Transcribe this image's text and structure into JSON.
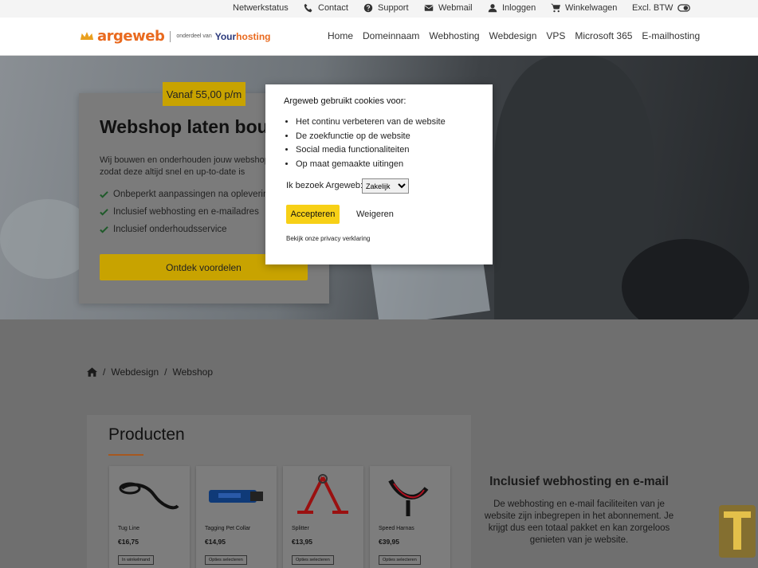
{
  "topbar": {
    "network_status": "Netwerkstatus",
    "contact": "Contact",
    "support": "Support",
    "webmail": "Webmail",
    "login": "Inloggen",
    "cart": "Winkelwagen",
    "vat": "Excl. BTW"
  },
  "logo": {
    "brand": "argeweb",
    "sub": "onderdeel van",
    "partner_a": "Your",
    "partner_b": "hosting"
  },
  "menu": [
    "Home",
    "Domeinnaam",
    "Webhosting",
    "Webdesign",
    "VPS",
    "Microsoft 365",
    "E-mailhosting"
  ],
  "hero": {
    "price_badge": "Vanaf 55,00 p/m",
    "title": "Webshop laten bouwen",
    "text": "Wij bouwen en onderhouden jouw webshop, zodat deze altijd snel en up-to-date is",
    "checks": [
      "Onbeperkt aanpassingen na oplevering",
      "Inclusief webhosting en e-mailadres",
      "Inclusief onderhoudsservice"
    ],
    "cta": "Ontdek voordelen"
  },
  "breadcrumb": {
    "home_icon": "home-icon",
    "items": [
      "Webdesign",
      "Webshop"
    ],
    "separator": "/"
  },
  "products": {
    "title": "Producten",
    "items": [
      {
        "name": "Tug Line",
        "price": "€16,75",
        "button": "In winkelmand",
        "icon": "leash"
      },
      {
        "name": "Tagging Pet Collar",
        "price": "€14,95",
        "button": "Opties selecteren",
        "icon": "collar"
      },
      {
        "name": "Splitter",
        "price": "€13,95",
        "button": "Opties selecteren",
        "icon": "splitter"
      },
      {
        "name": "Speed Harnas",
        "price": "€39,95",
        "button": "Opties selecteren",
        "icon": "harness"
      }
    ]
  },
  "side": {
    "title": "Inclusief webhosting en e-mail",
    "text": "De webhosting en e-mail faciliteiten van je website zijn inbegrepen in het abonnement. Je krijgt dus een totaal pakket en kan zorgeloos genieten van je website."
  },
  "cookie": {
    "heading": "Argeweb gebruikt cookies voor:",
    "items": [
      "Het continu verbeteren van de website",
      "De zoekfunctie op de website",
      "Social media functionaliteiten",
      "Op maat gemaakte uitingen"
    ],
    "visit_label": "Ik bezoek Argeweb:",
    "visit_value": "Zakelijk",
    "accept": "Accepteren",
    "reject": "Weigeren",
    "privacy": "Bekijk onze privacy verklaring"
  },
  "colors": {
    "accent": "#f7d016",
    "brand": "#e96a1f",
    "partner": "#2c3a7c"
  }
}
